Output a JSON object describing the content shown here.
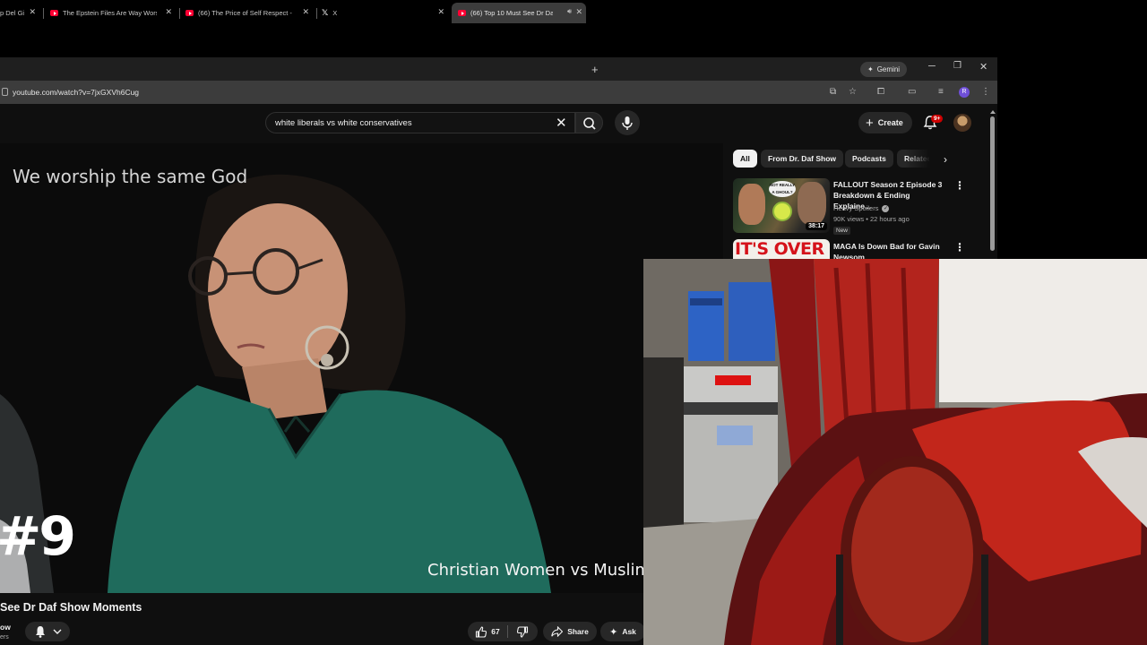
{
  "browser": {
    "tabs": [
      {
        "title": "p Del Gi"
      },
      {
        "title": "The Epstein Files Are Way Wors"
      },
      {
        "title": "(66) The Price of Self Respect -"
      },
      {
        "title": "X"
      },
      {
        "title": "(66) Top 10 Must See Dr Da"
      }
    ],
    "gemini_label": "Gemini",
    "url": "youtube.com/watch?v=7jxGXVh6Cug",
    "profile_initial": "R"
  },
  "youtube": {
    "search_value": "white liberals vs white conservatives",
    "create_label": "Create",
    "notification_count": "9+",
    "video": {
      "overlay_text": "We worship the same God",
      "rank_label": "#9",
      "caption": "Christian Women vs Muslim",
      "title": "See Dr Daf Show Moments",
      "channel_name": "ow",
      "channel_subs": "ers",
      "like_count": "67",
      "share_label": "Share",
      "ask_label": "Ask"
    },
    "chips": [
      "All",
      "From Dr. Daf Show",
      "Podcasts",
      "Related"
    ],
    "recommendations": [
      {
        "title": "FALLOUT Season 2 Episode 3 Breakdown & Ending Explaine...",
        "channel": "Heavy Spoilers",
        "meta": "90K views • 22 hours ago",
        "badge": "New",
        "duration": "38:17",
        "thumb_text": "NOT REALLY A GHOUL?"
      },
      {
        "title": "MAGA Is Down Bad for Gavin Newsom",
        "thumb_text": "IT'S OVER"
      }
    ]
  }
}
